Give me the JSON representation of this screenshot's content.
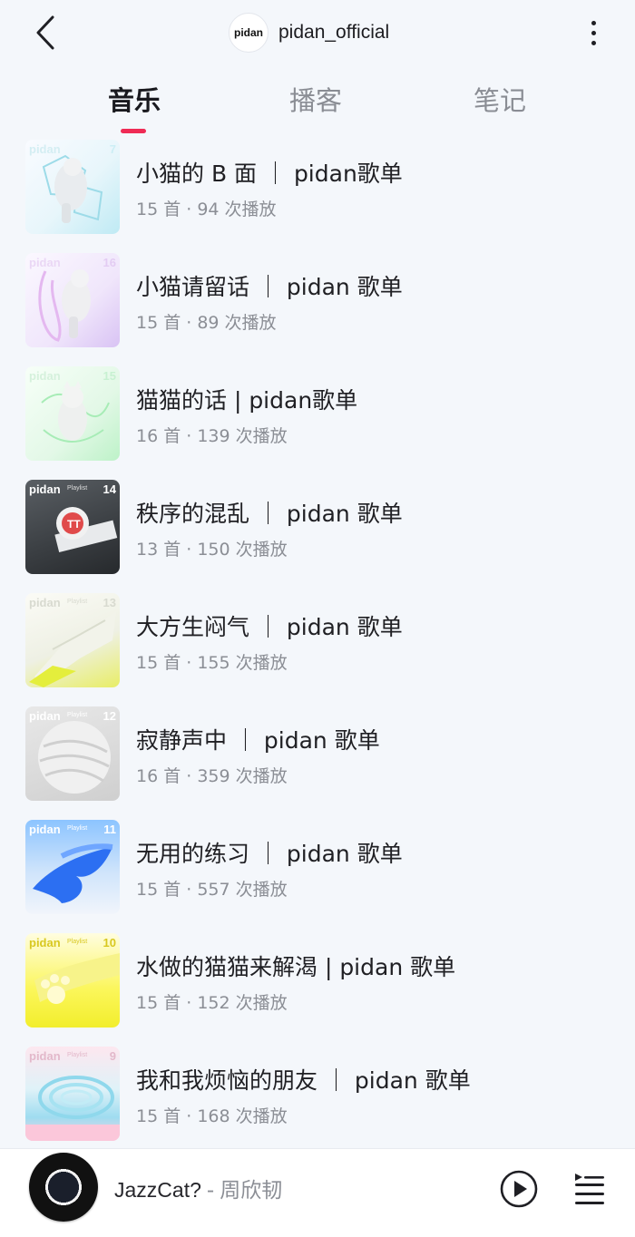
{
  "header": {
    "logo_text": "pidan",
    "account_name": "pidan_official"
  },
  "tabs": [
    {
      "label": "音乐",
      "active": true
    },
    {
      "label": "播客",
      "active": false
    },
    {
      "label": "笔记",
      "active": false
    }
  ],
  "accent_color": "#ef2b55",
  "playlists": [
    {
      "title": "小猫的 B 面 ｜ pidan歌单",
      "meta": "15 首 · 94 次播放",
      "cover_brand": "pidan",
      "cover_number": "7"
    },
    {
      "title": "小猫请留话 ｜ pidan 歌单",
      "meta": "15 首 · 89 次播放",
      "cover_brand": "pidan",
      "cover_number": "16"
    },
    {
      "title": "猫猫的话 | pidan歌单",
      "meta": "16 首 · 139 次播放",
      "cover_brand": "pidan",
      "cover_number": "15"
    },
    {
      "title": "秩序的混乱 ｜ pidan 歌单",
      "meta": "13 首 · 150 次播放",
      "cover_brand": "pidan",
      "cover_sub": "Playlist",
      "cover_number": "14"
    },
    {
      "title": "大方生闷气 ｜ pidan 歌单",
      "meta": "15 首 · 155 次播放",
      "cover_brand": "pidan",
      "cover_sub": "Playlist",
      "cover_number": "13"
    },
    {
      "title": "寂静声中 ｜ pidan 歌单",
      "meta": "16 首 · 359 次播放",
      "cover_brand": "pidan",
      "cover_sub": "Playlist",
      "cover_number": "12"
    },
    {
      "title": "无用的练习 ｜ pidan 歌单",
      "meta": "15 首 · 557 次播放",
      "cover_brand": "pidan",
      "cover_sub": "Playlist",
      "cover_number": "11"
    },
    {
      "title": "水做的猫猫来解渴 | pidan 歌单",
      "meta": "15 首 · 152 次播放",
      "cover_brand": "pidan",
      "cover_sub": "Playlist",
      "cover_number": "10"
    },
    {
      "title": "我和我烦恼的朋友 ｜ pidan 歌单",
      "meta": "15 首 · 168 次播放",
      "cover_brand": "pidan",
      "cover_sub": "Playlist",
      "cover_number": "9"
    }
  ],
  "player": {
    "track_name": "JazzCat?",
    "separator": "-",
    "artist": "周欣韧"
  },
  "icons": {
    "back": "chevron-left-icon",
    "more": "more-vertical-icon",
    "play": "play-circle-icon",
    "queue": "playlist-queue-icon"
  }
}
